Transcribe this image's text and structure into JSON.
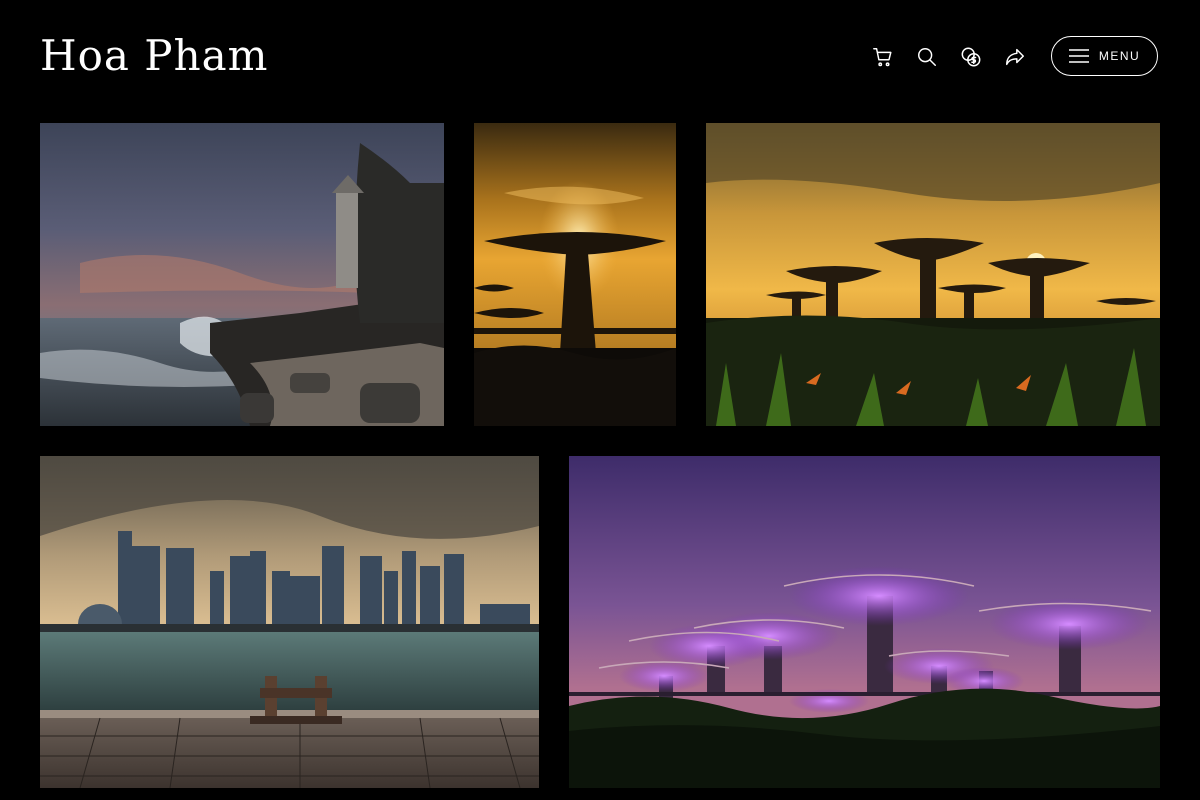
{
  "header": {
    "site_title": "Hoa Pham",
    "menu_label": "MENU"
  },
  "icons": [
    "cart-icon",
    "search-icon",
    "currency-icon",
    "share-icon",
    "hamburger-icon"
  ],
  "gallery": [
    {
      "subject": "lighthouse-coast"
    },
    {
      "subject": "supertree-sunset-portrait"
    },
    {
      "subject": "supertree-sunset-landscape"
    },
    {
      "subject": "city-skyline-waterfront"
    },
    {
      "subject": "supertree-purple-dusk"
    }
  ]
}
